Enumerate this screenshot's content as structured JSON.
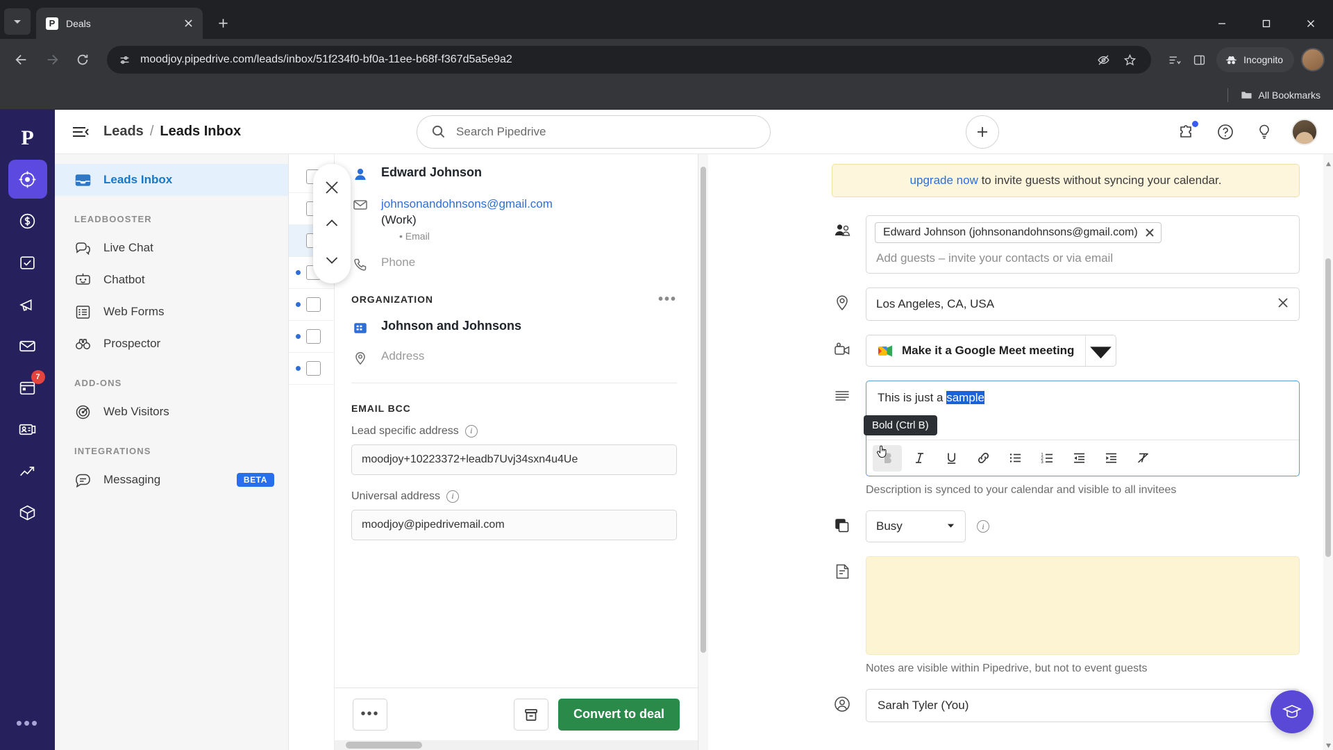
{
  "browser": {
    "tab": {
      "title": "Deals",
      "favicon_letter": "P"
    },
    "url": "moodjoy.pipedrive.com/leads/inbox/51f234f0-bf0a-11ee-b68f-f367d5a5e9a2",
    "incognito_label": "Incognito",
    "bookmarks_label": "All Bookmarks",
    "icons": {
      "tab_list": "chevron-down-icon",
      "close_tab": "close-icon",
      "new_tab": "plus-icon",
      "back": "back-arrow-icon",
      "forward": "forward-arrow-icon",
      "reload": "reload-icon",
      "site_info": "site-settings-icon",
      "tracking": "eye-off-icon",
      "bookmark": "star-icon",
      "reading_list": "reading-list-icon",
      "side_panel": "side-panel-icon",
      "incognito": "incognito-hat-icon",
      "minimize": "minimize-icon",
      "maximize": "maximize-icon",
      "close_window": "close-window-icon"
    }
  },
  "app": {
    "rail": {
      "logo": "P",
      "items": [
        {
          "name": "leads",
          "icon": "target-icon",
          "active": true,
          "badge": ""
        },
        {
          "name": "deals",
          "icon": "dollar-circle-icon",
          "active": false,
          "badge": ""
        },
        {
          "name": "activities",
          "icon": "checkbox-icon",
          "active": false,
          "badge": ""
        },
        {
          "name": "campaigns",
          "icon": "megaphone-icon",
          "active": false,
          "badge": ""
        },
        {
          "name": "mail",
          "icon": "envelope-icon",
          "active": false,
          "badge": ""
        },
        {
          "name": "calendar",
          "icon": "calendar-icon",
          "active": false,
          "badge": "7"
        },
        {
          "name": "contacts",
          "icon": "contact-card-icon",
          "active": false,
          "badge": ""
        },
        {
          "name": "insights",
          "icon": "chart-line-icon",
          "active": false,
          "badge": ""
        },
        {
          "name": "products",
          "icon": "box-icon",
          "active": false,
          "badge": ""
        }
      ],
      "more": "•••"
    },
    "topbar": {
      "breadcrumb_parent": "Leads",
      "breadcrumb_sep": "/",
      "breadcrumb_current": "Leads Inbox",
      "search_placeholder": "Search Pipedrive"
    },
    "sidebar": {
      "primary": {
        "label": "Leads Inbox",
        "icon": "inbox-icon"
      },
      "groups": [
        {
          "heading": "LEADBOOSTER",
          "items": [
            {
              "label": "Live Chat",
              "icon": "chat-bubbles-icon"
            },
            {
              "label": "Chatbot",
              "icon": "robot-icon"
            },
            {
              "label": "Web Forms",
              "icon": "form-list-icon"
            },
            {
              "label": "Prospector",
              "icon": "binoculars-icon"
            }
          ]
        },
        {
          "heading": "ADD-ONS",
          "items": [
            {
              "label": "Web Visitors",
              "icon": "radar-icon"
            }
          ]
        },
        {
          "heading": "INTEGRATIONS",
          "items": [
            {
              "label": "Messaging",
              "icon": "message-icon",
              "badge": "BETA"
            }
          ]
        }
      ]
    },
    "lead_detail": {
      "person_name": "Edward Johnson",
      "email": "johnsonandohnsons@gmail.com",
      "email_label": "(Work)",
      "email_sub": "Email",
      "phone_placeholder": "Phone",
      "organization_heading": "ORGANIZATION",
      "organization_more": "•••",
      "organization_name": "Johnson and Johnsons",
      "address_placeholder": "Address",
      "email_bcc_heading": "EMAIL BCC",
      "lead_specific_label": "Lead specific address",
      "lead_specific_value": "moodjoy+10223372+leadb7Uvj34sxn4u4Ue",
      "universal_label": "Universal address",
      "universal_value": "moodjoy@pipedrivemail.com",
      "footer": {
        "more_label": "•••",
        "archive_icon": "archive-icon",
        "convert_label": "Convert to deal"
      },
      "nav": {
        "close_icon": "close-icon",
        "prev_icon": "chevron-up-icon",
        "next_icon": "chevron-down-icon"
      }
    },
    "event_form": {
      "banner_link": "upgrade now",
      "banner_text": " to invite guests without syncing your calendar.",
      "guests": {
        "icon": "people-icon",
        "chip": "Edward Johnson (johnsonandohnsons@gmail.com)",
        "chip_remove_icon": "close-icon",
        "placeholder": "Add guests – invite your contacts or via email"
      },
      "location": {
        "icon": "location-pin-icon",
        "value": "Los Angeles, CA, USA",
        "clear_icon": "close-icon"
      },
      "conference": {
        "icon": "video-camera-icon",
        "label": "Make it a Google Meet meeting",
        "caret_icon": "chevron-down-icon"
      },
      "description": {
        "icon": "description-lines-icon",
        "text_plain": "This is just a ",
        "text_selected": "sample",
        "help": "Description is synced to your calendar and visible to all invitees",
        "tooltip": "Bold (Ctrl B)",
        "toolbar": [
          {
            "name": "bold",
            "icon": "bold-icon",
            "active": true
          },
          {
            "name": "italic",
            "icon": "italic-icon",
            "active": false
          },
          {
            "name": "underline",
            "icon": "underline-icon",
            "active": false
          },
          {
            "name": "link",
            "icon": "link-icon",
            "active": false
          },
          {
            "name": "bulleted-list",
            "icon": "bulleted-list-icon",
            "active": false
          },
          {
            "name": "numbered-list",
            "icon": "numbered-list-icon",
            "active": false
          },
          {
            "name": "outdent",
            "icon": "outdent-icon",
            "active": false
          },
          {
            "name": "indent",
            "icon": "indent-icon",
            "active": false
          },
          {
            "name": "clear-formatting",
            "icon": "clear-formatting-icon",
            "active": false
          }
        ]
      },
      "busy": {
        "icon": "layers-icon",
        "value": "Busy",
        "caret_icon": "chevron-down-icon",
        "info_icon": "info-icon"
      },
      "notes": {
        "icon": "note-icon",
        "value": "",
        "help": "Notes are visible within Pipedrive, but not to event guests"
      },
      "owner": {
        "icon": "person-circle-icon",
        "value": "Sarah Tyler (You)",
        "caret_icon": "chevron-down-icon"
      }
    },
    "help_fab_icon": "graduation-cap-icon"
  }
}
